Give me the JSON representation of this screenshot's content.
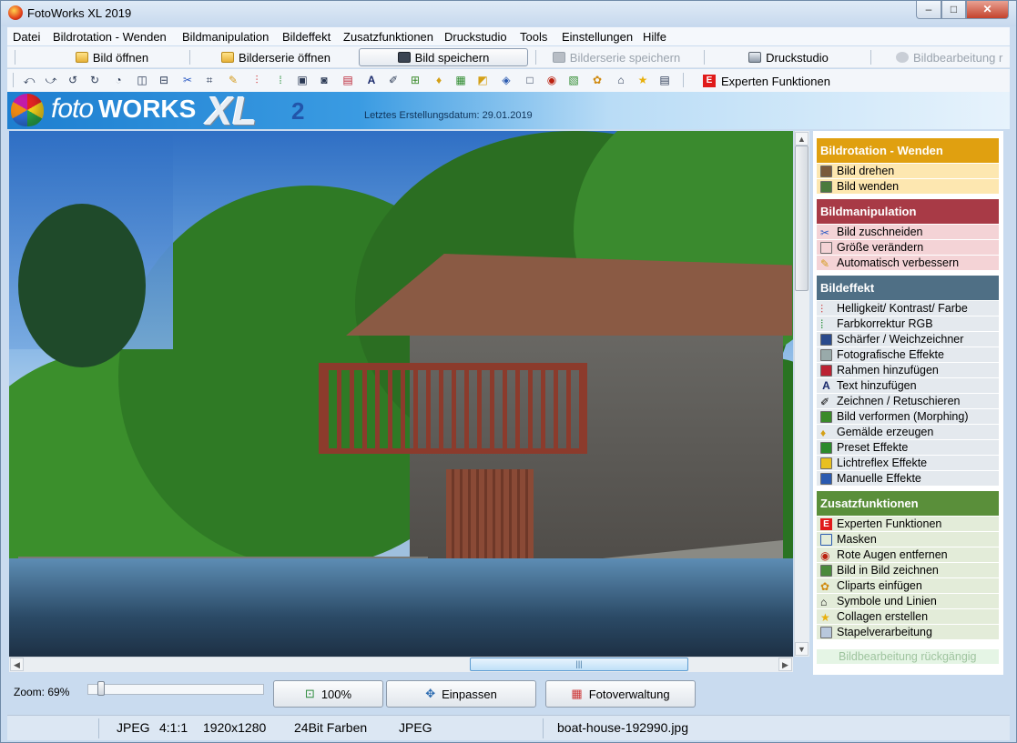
{
  "window": {
    "title": "FotoWorks XL 2019",
    "controls": {
      "minimize": "–",
      "maximize": "□",
      "close": "✕"
    }
  },
  "menu": [
    {
      "label": "Datei"
    },
    {
      "label": "Bildrotation - Wenden"
    },
    {
      "label": "Bildmanipulation"
    },
    {
      "label": "Bildeffekt"
    },
    {
      "label": "Zusatzfunktionen"
    },
    {
      "label": "Druckstudio"
    },
    {
      "label": "Tools"
    },
    {
      "label": "Einstellungen"
    },
    {
      "label": "Hilfe"
    }
  ],
  "toolbar": {
    "open_image": "Bild öffnen",
    "open_series": "Bilderserie öffnen",
    "save_image": "Bild speichern",
    "save_series": "Bilderserie speichern",
    "print_studio": "Druckstudio",
    "undo_edit": "Bildbearbeitung r",
    "expert_functions": "Experten Funktionen"
  },
  "icon_toolbar": [
    "rotate-left-icon",
    "rotate-right-icon",
    "rotate-ccw-icon",
    "rotate-cw-icon",
    "rotate-custom-icon",
    "flip-horizontal-icon",
    "flip-vertical-icon",
    "crop-icon",
    "resize-icon",
    "auto-enhance-icon",
    "levels-icon",
    "color-rgb-icon",
    "sharpen-icon",
    "photo-effects-icon",
    "frame-icon",
    "text-icon",
    "draw-icon",
    "morph-icon",
    "painting-icon",
    "preset-effects-icon",
    "lightreflex-icon",
    "manual-effects-icon",
    "mask-icon",
    "red-eye-icon",
    "image-in-image-icon",
    "clipart-icon",
    "symbols-icon",
    "collage-icon",
    "batch-icon"
  ],
  "banner": {
    "logo_foto": "foto",
    "logo_works": "WORKS",
    "logo_xl": "XL",
    "logo_version": "2",
    "build_date": "Letztes Erstellungsdatum: 29.01.2019"
  },
  "zoom": {
    "label": "Zoom: 69%",
    "level_percent": 69,
    "btn_100": "100%",
    "btn_fit": "Einpassen",
    "btn_manager": "Fotoverwaltung"
  },
  "status": {
    "format": "JPEG",
    "sampling": "4:1:1",
    "dimensions": "1920x1280",
    "color_depth": "24Bit Farben",
    "format2": "JPEG",
    "filename": "boat-house-192990.jpg"
  },
  "sidepanel": {
    "rotation": {
      "title": "Bildrotation - Wenden",
      "color": "#e0a010",
      "items": [
        "Bild drehen",
        "Bild wenden"
      ]
    },
    "manipulation": {
      "title": "Bildmanipulation",
      "color": "#a83a46",
      "items": [
        "Bild zuschneiden",
        "Größe verändern",
        "Automatisch verbessern"
      ]
    },
    "effect": {
      "title": "Bildeffekt",
      "color": "#4f6f85",
      "items": [
        "Helligkeit/ Kontrast/ Farbe",
        "Farbkorrektur RGB",
        "Schärfer / Weichzeichner",
        "Fotografische Effekte",
        "Rahmen hinzufügen",
        "Text hinzufügen",
        "Zeichnen / Retuschieren",
        "Bild verformen (Morphing)",
        "Gemälde erzeugen",
        "Preset Effekte",
        "Lichtreflex Effekte",
        "Manuelle Effekte"
      ]
    },
    "extras": {
      "title": "Zusatzfunktionen",
      "color": "#5a8f3a",
      "items": [
        "Experten Funktionen",
        "Masken",
        "Rote Augen entfernen",
        "Bild in Bild zeichnen",
        "Cliparts einfügen",
        "Symbole und Linien",
        "Collagen erstellen",
        "Stapelverarbeitung"
      ]
    },
    "undo": "Bildbearbeitung rückgängig"
  }
}
